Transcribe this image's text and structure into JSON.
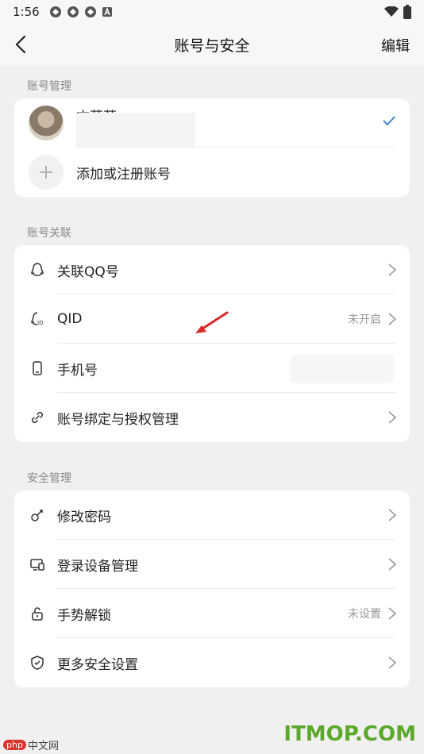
{
  "status_bar": {
    "time": "1:56"
  },
  "nav": {
    "title": "账号与安全",
    "edit_label": "编辑"
  },
  "accounts_section": {
    "label": "账号管理",
    "current_account_name": "亦莫莫",
    "add_account_label": "添加或注册账号"
  },
  "link_section": {
    "label": "账号关联",
    "items": [
      {
        "label": "关联QQ号",
        "value": "",
        "icon": "qq-icon"
      },
      {
        "label": "QID",
        "value": "未开启",
        "icon": "qid-icon"
      },
      {
        "label": "手机号",
        "value": "",
        "icon": "phone-icon"
      },
      {
        "label": "账号绑定与授权管理",
        "value": "",
        "icon": "link-icon"
      }
    ]
  },
  "security_section": {
    "label": "安全管理",
    "items": [
      {
        "label": "修改密码",
        "value": "",
        "icon": "key-icon"
      },
      {
        "label": "登录设备管理",
        "value": "",
        "icon": "device-icon"
      },
      {
        "label": "手势解锁",
        "value": "未设置",
        "icon": "lock-icon"
      },
      {
        "label": "更多安全设置",
        "value": "",
        "icon": "shield-icon"
      }
    ]
  },
  "watermarks": {
    "left_badge": "php",
    "left_text": "中文网",
    "right_text": "ITMOP.COM"
  },
  "colors": {
    "accent": "#3a7bd5",
    "background": "#f0f0f0",
    "annotation_arrow": "#d92b2b",
    "watermark_green": "#5ba82a"
  }
}
